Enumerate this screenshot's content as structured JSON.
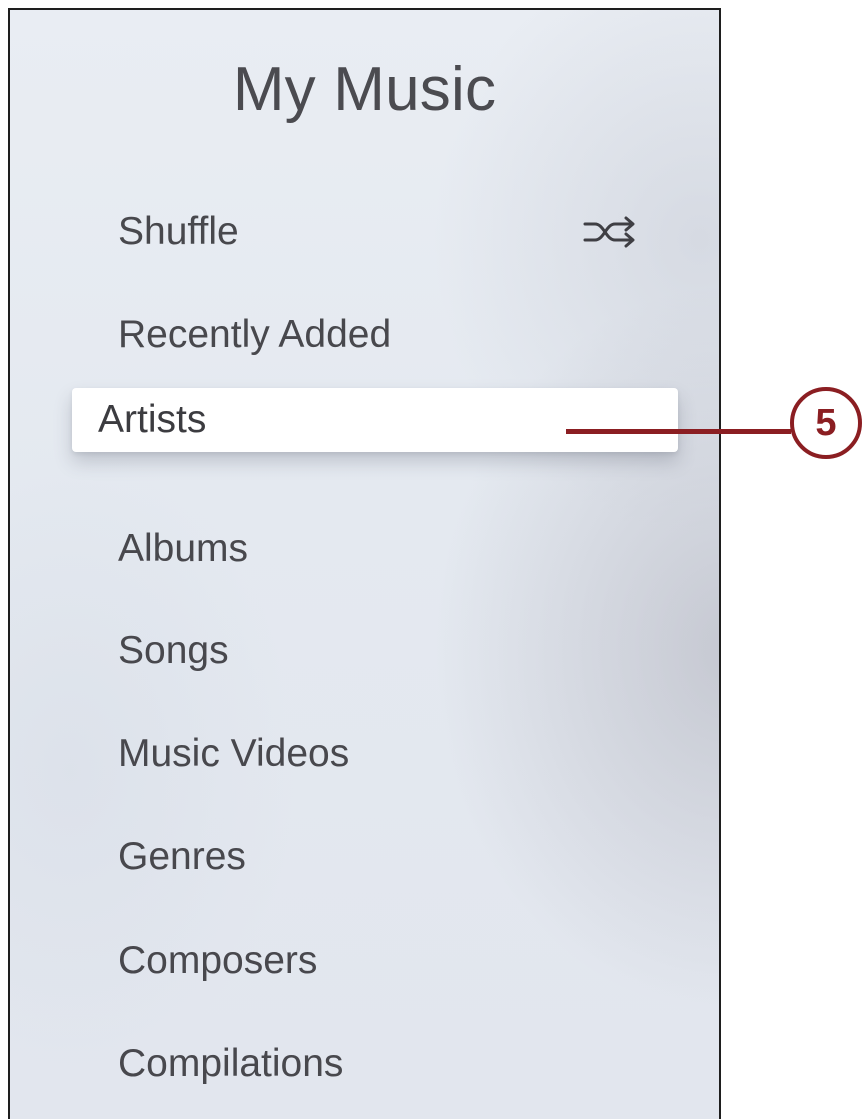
{
  "header": {
    "title": "My Music"
  },
  "menu": {
    "shuffle": {
      "label": "Shuffle",
      "icon": "shuffle-icon"
    },
    "items": [
      {
        "label": "Recently Added"
      },
      {
        "label": "Artists",
        "selected": true
      },
      {
        "label": "Albums"
      },
      {
        "label": "Songs"
      },
      {
        "label": "Music Videos"
      },
      {
        "label": "Genres"
      },
      {
        "label": "Composers"
      },
      {
        "label": "Compilations"
      }
    ]
  },
  "callout": {
    "number": "5",
    "color": "#8b1e22"
  }
}
